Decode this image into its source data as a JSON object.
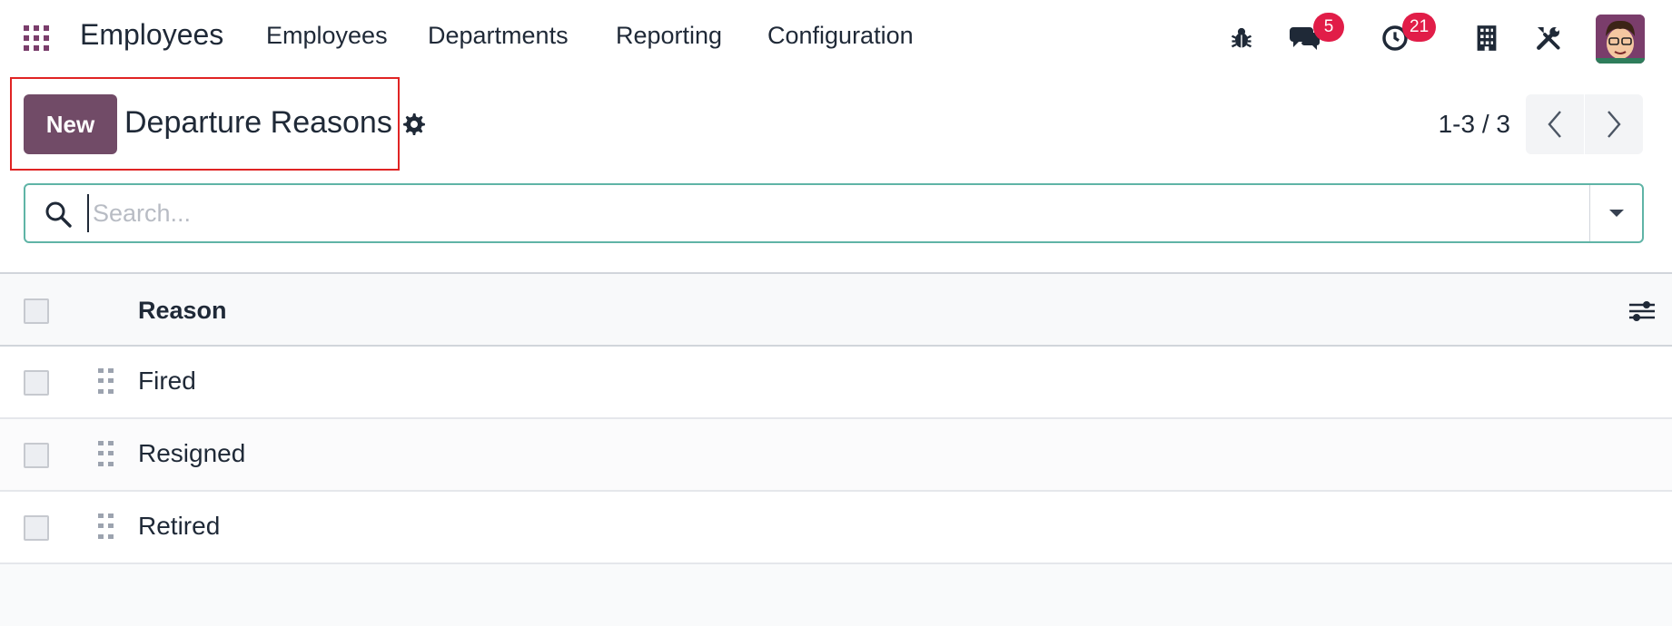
{
  "navbar": {
    "brand": "Employees",
    "menu": [
      "Employees",
      "Departments",
      "Reporting",
      "Configuration"
    ],
    "icons": {
      "apps": "apps-grid-icon",
      "debug": "bug-icon",
      "messages": "chat-icon",
      "activities": "clock-icon",
      "company": "building-icon",
      "settings": "tools-icon"
    },
    "messages_badge": "5",
    "activities_badge": "21"
  },
  "control_panel": {
    "new_label": "New",
    "title": "Departure Reasons",
    "pager": "1-3 / 3"
  },
  "search": {
    "placeholder": "Search..."
  },
  "table": {
    "columns": [
      "Reason"
    ],
    "rows": [
      {
        "reason": "Fired"
      },
      {
        "reason": "Resigned"
      },
      {
        "reason": "Retired"
      }
    ]
  },
  "colors": {
    "brand": "#714b67",
    "search_border": "#5fb4a6",
    "badge": "#e11d48",
    "highlight": "#e02424"
  }
}
